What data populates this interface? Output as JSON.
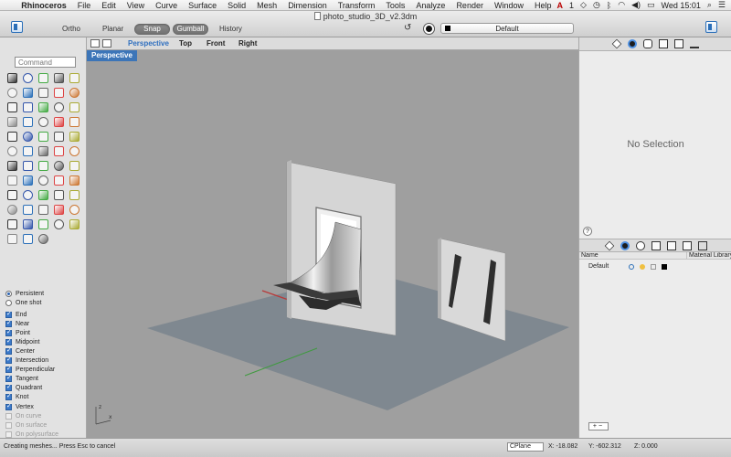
{
  "menubar": {
    "items": [
      "Rhinoceros",
      "File",
      "Edit",
      "View",
      "Curve",
      "Surface",
      "Solid",
      "Mesh",
      "Dimension",
      "Transform",
      "Tools",
      "Analyze",
      "Render",
      "Window",
      "Help"
    ],
    "status_badge": "1",
    "clock": "Wed 15:01"
  },
  "titlebar": {
    "document_title": "photo_studio_3D_v2.3dm",
    "ortho": "Ortho",
    "planar": "Planar",
    "snap": "Snap",
    "gumball": "Gumball",
    "history": "History",
    "layer": "Default"
  },
  "left": {
    "command_placeholder": "Command",
    "osnap": {
      "persistent": "Persistent",
      "one_shot": "One shot",
      "items": [
        {
          "label": "End",
          "on": true
        },
        {
          "label": "Near",
          "on": true
        },
        {
          "label": "Point",
          "on": true
        },
        {
          "label": "Midpoint",
          "on": true
        },
        {
          "label": "Center",
          "on": true
        },
        {
          "label": "Intersection",
          "on": true
        },
        {
          "label": "Perpendicular",
          "on": true
        },
        {
          "label": "Tangent",
          "on": true
        },
        {
          "label": "Quadrant",
          "on": true
        },
        {
          "label": "Knot",
          "on": true
        },
        {
          "label": "Vertex",
          "on": true
        },
        {
          "label": "On curve",
          "on": false
        },
        {
          "label": "On surface",
          "on": false
        },
        {
          "label": "On polysurface",
          "on": false
        }
      ]
    }
  },
  "viewport": {
    "tabs": [
      "Perspective",
      "Top",
      "Front",
      "Right"
    ],
    "active_tab": "Perspective",
    "label": "Perspective",
    "axis_x": "x",
    "axis_z": "z"
  },
  "right": {
    "no_selection": "No Selection",
    "help": "?",
    "layer_col_name": "Name",
    "layer_col_material": "Material Library",
    "layer_name": "Default",
    "plus_minus": "+−"
  },
  "status": {
    "message": "Creating meshes... Press Esc to cancel",
    "cplane": "CPlane",
    "x": "X: -18.082",
    "y": "Y: -602.312",
    "z": "Z: 0.000"
  }
}
